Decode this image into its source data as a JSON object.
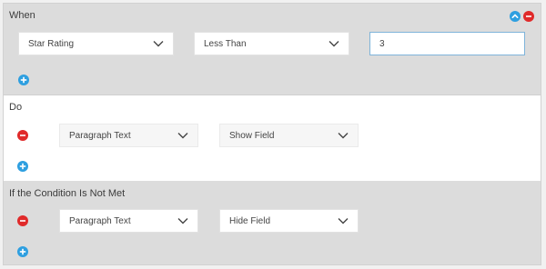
{
  "when": {
    "title": "When",
    "field_select": "Star Rating",
    "operator_select": "Less Than",
    "value_input": "3"
  },
  "do": {
    "title": "Do",
    "field_select": "Paragraph Text",
    "action_select": "Show Field"
  },
  "else": {
    "title": "If the Condition Is Not Met",
    "field_select": "Paragraph Text",
    "action_select": "Hide Field"
  },
  "colors": {
    "add": "#2e9fe0",
    "remove": "#e02a2a",
    "collapse": "#2e9fe0"
  },
  "icons": [
    "chevron-down-icon",
    "plus-circle-icon",
    "minus-circle-icon",
    "chevron-up-circle-icon"
  ]
}
